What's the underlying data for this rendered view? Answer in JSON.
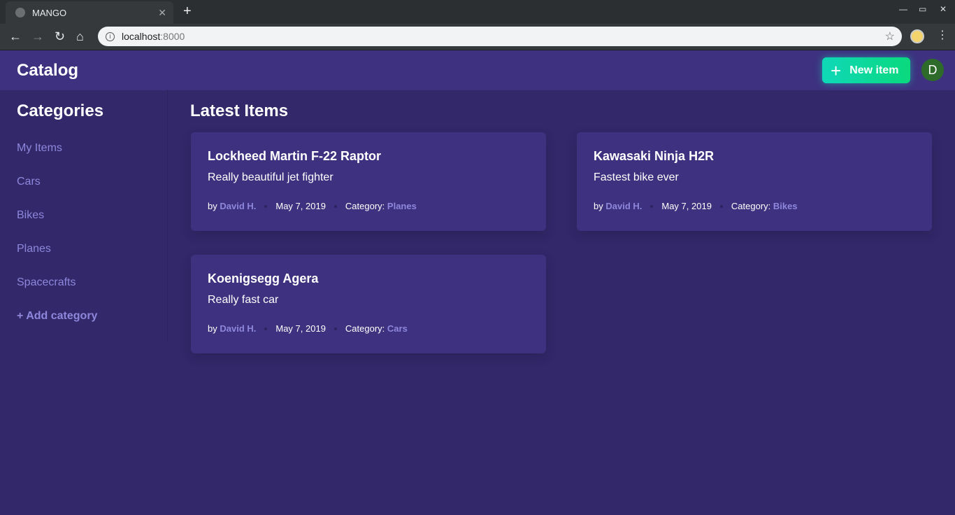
{
  "browser": {
    "tab_title": "MANGO",
    "url_host": "localhost",
    "url_port": ":8000"
  },
  "app": {
    "title": "Catalog",
    "new_item_label": "New item",
    "avatar_initial": "D"
  },
  "sidebar": {
    "heading": "Categories",
    "items": [
      {
        "label": "My Items"
      },
      {
        "label": "Cars"
      },
      {
        "label": "Bikes"
      },
      {
        "label": "Planes"
      },
      {
        "label": "Spacecrafts"
      }
    ],
    "add_label": "+ Add category"
  },
  "main": {
    "heading": "Latest Items",
    "items": [
      {
        "title": "Lockheed Martin F-22 Raptor",
        "description": "Really beautiful jet fighter",
        "by": "by",
        "author": "David H.",
        "date": "May 7, 2019",
        "category_label": "Category:",
        "category": "Planes"
      },
      {
        "title": "Kawasaki Ninja H2R",
        "description": "Fastest bike ever",
        "by": "by",
        "author": "David H.",
        "date": "May 7, 2019",
        "category_label": "Category:",
        "category": "Bikes"
      },
      {
        "title": "Koenigsegg Agera",
        "description": "Really fast car",
        "by": "by",
        "author": "David H.",
        "date": "May 7, 2019",
        "category_label": "Category:",
        "category": "Cars"
      }
    ]
  }
}
